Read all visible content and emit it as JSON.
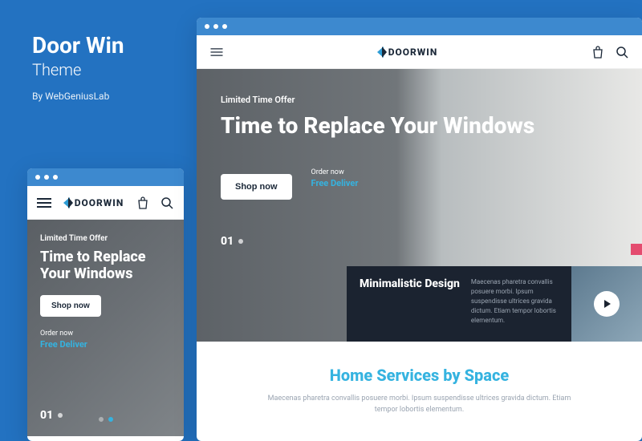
{
  "left": {
    "title": "Door Win",
    "subtitle": "Theme",
    "byline": "By WebGeniusLab"
  },
  "brand": "DOORWIN",
  "hero": {
    "offer": "Limited Time Offer",
    "title": "Time to Replace Your Windows",
    "shop_label": "Shop now",
    "order_label": "Order now",
    "deliver_label": "Free Deliver",
    "slide_number": "01"
  },
  "feature": {
    "title": "Minimalistic Design",
    "desc": "Maecenas pharetra convallis posuere morbi. Ipsum suspendisse ultrices gravida dictum. Etiam tempor lobortis elementum."
  },
  "home_services": {
    "title_a": "Home Services by ",
    "title_b": "Space",
    "desc": "Maecenas pharetra convallis posuere morbi. Ipsum suspendisse ultrices gravida dictum. Etiam tempor lobortis elementum."
  }
}
